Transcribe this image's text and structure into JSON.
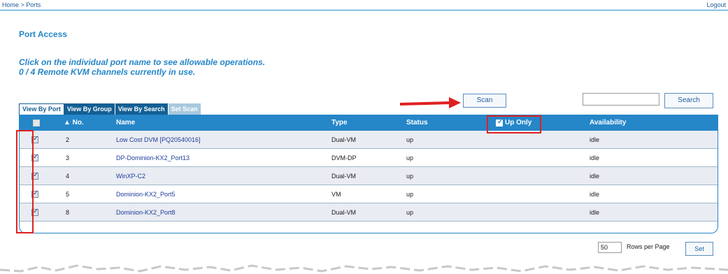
{
  "header": {
    "breadcrumb": "Home > Ports",
    "logout": "Logout"
  },
  "page": {
    "title": "Port Access",
    "instruction_line1": "Click on the individual port name to see allowable operations.",
    "instruction_line2": "0 / 4 Remote KVM channels currently in use."
  },
  "controls": {
    "scan_label": "Scan",
    "search_label": "Search",
    "search_value": ""
  },
  "tabs": [
    {
      "label": "View By Port",
      "active": true
    },
    {
      "label": "View By Group",
      "active": false
    },
    {
      "label": "View By Search",
      "active": false
    },
    {
      "label": "Set Scan",
      "active": false
    }
  ],
  "table": {
    "columns": {
      "no": "▲ No.",
      "name": "Name",
      "type": "Type",
      "status": "Status",
      "up_only": "Up Only",
      "availability": "Availability"
    },
    "up_only_checked": true,
    "rows": [
      {
        "checked": true,
        "no": "2",
        "name": "Low Cost DVM [PQ20540016]",
        "type": "Dual-VM",
        "status": "up",
        "availability": "idle"
      },
      {
        "checked": true,
        "no": "3",
        "name": "DP-Dominion-KX2_Port13",
        "type": "DVM-DP",
        "status": "up",
        "availability": "idle"
      },
      {
        "checked": true,
        "no": "4",
        "name": "WinXP-C2",
        "type": "Dual-VM",
        "status": "up",
        "availability": "idle"
      },
      {
        "checked": true,
        "no": "5",
        "name": "Dominion-KX2_Port5",
        "type": "VM",
        "status": "up",
        "availability": "idle"
      },
      {
        "checked": true,
        "no": "8",
        "name": "Dominion-KX2_Port8",
        "type": "Dual-VM",
        "status": "up",
        "availability": "idle"
      }
    ]
  },
  "footer": {
    "rows_per_page_value": "50",
    "rows_per_page_label": "Rows per Page",
    "set_label": "Set"
  },
  "colors": {
    "accent": "#2586c8",
    "tab_dark": "#135f93",
    "annotation_red": "#e02020"
  }
}
